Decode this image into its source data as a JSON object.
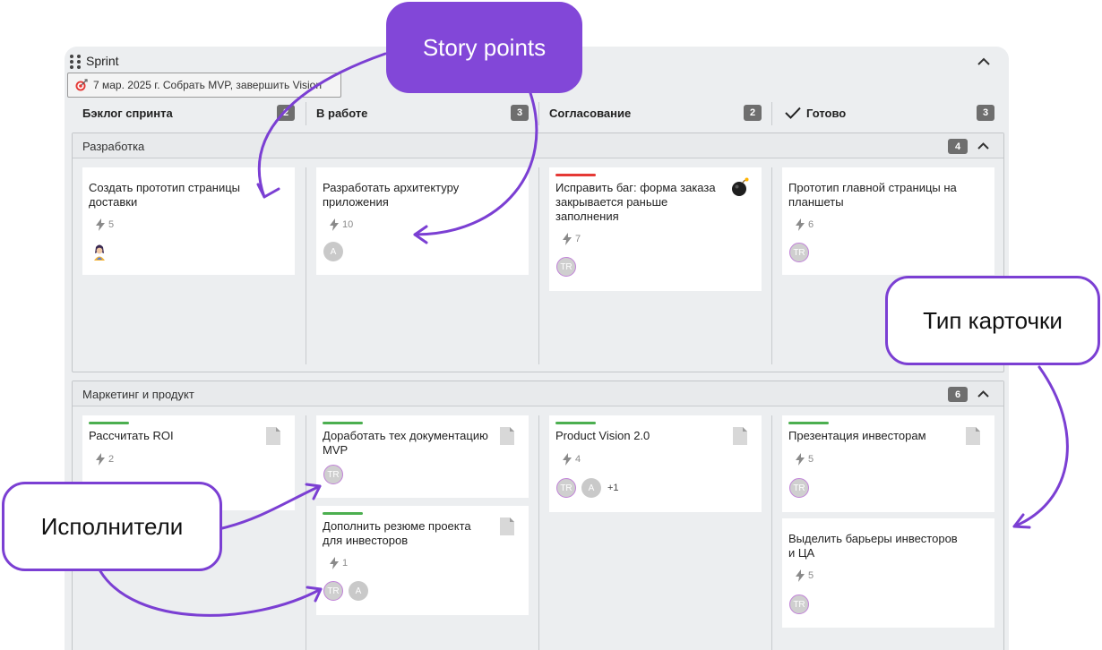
{
  "board": {
    "title": "Sprint",
    "sprint_goal": "7 мар. 2025 г. Собрать MVP, завершить Vision"
  },
  "columns": [
    {
      "name": "Бэклог спринта",
      "count": "2"
    },
    {
      "name": "В работе",
      "count": "3"
    },
    {
      "name": "Согласование",
      "count": "2"
    },
    {
      "name": "Готово",
      "count": "3"
    }
  ],
  "lanes": [
    {
      "title": "Разработка",
      "count": "4",
      "cards": [
        {
          "title": "Создать прототип страницы доставки",
          "points": "5"
        },
        {
          "title": "Разработать архитектуру приложения",
          "points": "10",
          "assignee": "A"
        },
        {
          "title": "Исправить баг: форма заказа закрывается раньше заполнения",
          "points": "7",
          "assignee": "TR",
          "type_icon": "bomb-icon",
          "stripe": "#e53935"
        },
        {
          "title": "Прототип главной страницы на планшеты",
          "points": "6",
          "assignee": "TR"
        }
      ]
    },
    {
      "title": "Маркетинг и продукт",
      "count": "6",
      "cards": [
        {
          "title": "Рассчитать ROI",
          "points": "2",
          "type_icon": "document-icon",
          "stripe": "#4caf50"
        },
        {
          "title": "Доработать тех документацию MVP",
          "assignee": "TR",
          "type_icon": "document-icon",
          "stripe": "#4caf50"
        },
        {
          "title": "Дополнить резюме проекта для инвесторов",
          "points": "1",
          "assignees": [
            "TR",
            "A"
          ],
          "type_icon": "document-icon",
          "stripe": "#4caf50"
        },
        {
          "title": "Product Vision 2.0",
          "points": "4",
          "assignees": [
            "TR",
            "A"
          ],
          "extra": "+1",
          "type_icon": "document-icon",
          "stripe": "#4caf50"
        },
        {
          "title": "Презентация инвесторам",
          "points": "5",
          "assignee": "TR",
          "type_icon": "document-icon",
          "stripe": "#4caf50"
        },
        {
          "title": "Выделить барьеры инвесторов и ЦА",
          "points": "5",
          "assignee": "TR"
        }
      ]
    }
  ],
  "callouts": {
    "story_points": "Story points",
    "card_type": "Тип карточки",
    "assignees": "Исполнители"
  },
  "colors": {
    "accent": "#8247d8",
    "board_bg": "#eceef0",
    "badge": "#6e6e6e"
  }
}
